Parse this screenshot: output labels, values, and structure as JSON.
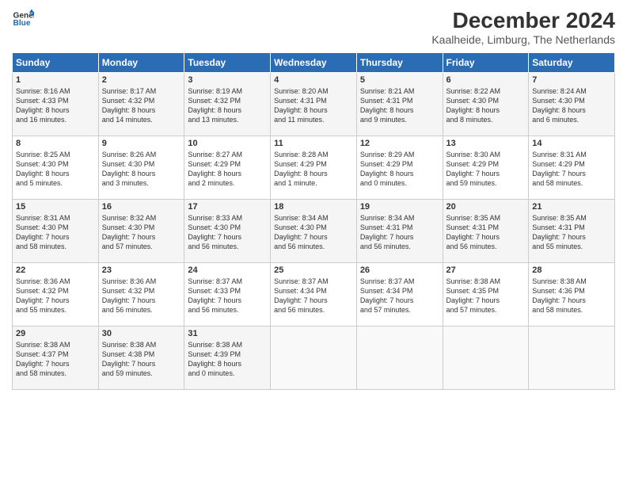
{
  "logo": {
    "line1": "General",
    "line2": "Blue"
  },
  "title": "December 2024",
  "subtitle": "Kaalheide, Limburg, The Netherlands",
  "weekdays": [
    "Sunday",
    "Monday",
    "Tuesday",
    "Wednesday",
    "Thursday",
    "Friday",
    "Saturday"
  ],
  "weeks": [
    [
      {
        "day": "1",
        "info": "Sunrise: 8:16 AM\nSunset: 4:33 PM\nDaylight: 8 hours\nand 16 minutes."
      },
      {
        "day": "2",
        "info": "Sunrise: 8:17 AM\nSunset: 4:32 PM\nDaylight: 8 hours\nand 14 minutes."
      },
      {
        "day": "3",
        "info": "Sunrise: 8:19 AM\nSunset: 4:32 PM\nDaylight: 8 hours\nand 13 minutes."
      },
      {
        "day": "4",
        "info": "Sunrise: 8:20 AM\nSunset: 4:31 PM\nDaylight: 8 hours\nand 11 minutes."
      },
      {
        "day": "5",
        "info": "Sunrise: 8:21 AM\nSunset: 4:31 PM\nDaylight: 8 hours\nand 9 minutes."
      },
      {
        "day": "6",
        "info": "Sunrise: 8:22 AM\nSunset: 4:30 PM\nDaylight: 8 hours\nand 8 minutes."
      },
      {
        "day": "7",
        "info": "Sunrise: 8:24 AM\nSunset: 4:30 PM\nDaylight: 8 hours\nand 6 minutes."
      }
    ],
    [
      {
        "day": "8",
        "info": "Sunrise: 8:25 AM\nSunset: 4:30 PM\nDaylight: 8 hours\nand 5 minutes."
      },
      {
        "day": "9",
        "info": "Sunrise: 8:26 AM\nSunset: 4:30 PM\nDaylight: 8 hours\nand 3 minutes."
      },
      {
        "day": "10",
        "info": "Sunrise: 8:27 AM\nSunset: 4:29 PM\nDaylight: 8 hours\nand 2 minutes."
      },
      {
        "day": "11",
        "info": "Sunrise: 8:28 AM\nSunset: 4:29 PM\nDaylight: 8 hours\nand 1 minute."
      },
      {
        "day": "12",
        "info": "Sunrise: 8:29 AM\nSunset: 4:29 PM\nDaylight: 8 hours\nand 0 minutes."
      },
      {
        "day": "13",
        "info": "Sunrise: 8:30 AM\nSunset: 4:29 PM\nDaylight: 7 hours\nand 59 minutes."
      },
      {
        "day": "14",
        "info": "Sunrise: 8:31 AM\nSunset: 4:29 PM\nDaylight: 7 hours\nand 58 minutes."
      }
    ],
    [
      {
        "day": "15",
        "info": "Sunrise: 8:31 AM\nSunset: 4:30 PM\nDaylight: 7 hours\nand 58 minutes."
      },
      {
        "day": "16",
        "info": "Sunrise: 8:32 AM\nSunset: 4:30 PM\nDaylight: 7 hours\nand 57 minutes."
      },
      {
        "day": "17",
        "info": "Sunrise: 8:33 AM\nSunset: 4:30 PM\nDaylight: 7 hours\nand 56 minutes."
      },
      {
        "day": "18",
        "info": "Sunrise: 8:34 AM\nSunset: 4:30 PM\nDaylight: 7 hours\nand 56 minutes."
      },
      {
        "day": "19",
        "info": "Sunrise: 8:34 AM\nSunset: 4:31 PM\nDaylight: 7 hours\nand 56 minutes."
      },
      {
        "day": "20",
        "info": "Sunrise: 8:35 AM\nSunset: 4:31 PM\nDaylight: 7 hours\nand 56 minutes."
      },
      {
        "day": "21",
        "info": "Sunrise: 8:35 AM\nSunset: 4:31 PM\nDaylight: 7 hours\nand 55 minutes."
      }
    ],
    [
      {
        "day": "22",
        "info": "Sunrise: 8:36 AM\nSunset: 4:32 PM\nDaylight: 7 hours\nand 55 minutes."
      },
      {
        "day": "23",
        "info": "Sunrise: 8:36 AM\nSunset: 4:32 PM\nDaylight: 7 hours\nand 56 minutes."
      },
      {
        "day": "24",
        "info": "Sunrise: 8:37 AM\nSunset: 4:33 PM\nDaylight: 7 hours\nand 56 minutes."
      },
      {
        "day": "25",
        "info": "Sunrise: 8:37 AM\nSunset: 4:34 PM\nDaylight: 7 hours\nand 56 minutes."
      },
      {
        "day": "26",
        "info": "Sunrise: 8:37 AM\nSunset: 4:34 PM\nDaylight: 7 hours\nand 57 minutes."
      },
      {
        "day": "27",
        "info": "Sunrise: 8:38 AM\nSunset: 4:35 PM\nDaylight: 7 hours\nand 57 minutes."
      },
      {
        "day": "28",
        "info": "Sunrise: 8:38 AM\nSunset: 4:36 PM\nDaylight: 7 hours\nand 58 minutes."
      }
    ],
    [
      {
        "day": "29",
        "info": "Sunrise: 8:38 AM\nSunset: 4:37 PM\nDaylight: 7 hours\nand 58 minutes."
      },
      {
        "day": "30",
        "info": "Sunrise: 8:38 AM\nSunset: 4:38 PM\nDaylight: 7 hours\nand 59 minutes."
      },
      {
        "day": "31",
        "info": "Sunrise: 8:38 AM\nSunset: 4:39 PM\nDaylight: 8 hours\nand 0 minutes."
      },
      {
        "day": "",
        "info": ""
      },
      {
        "day": "",
        "info": ""
      },
      {
        "day": "",
        "info": ""
      },
      {
        "day": "",
        "info": ""
      }
    ]
  ]
}
